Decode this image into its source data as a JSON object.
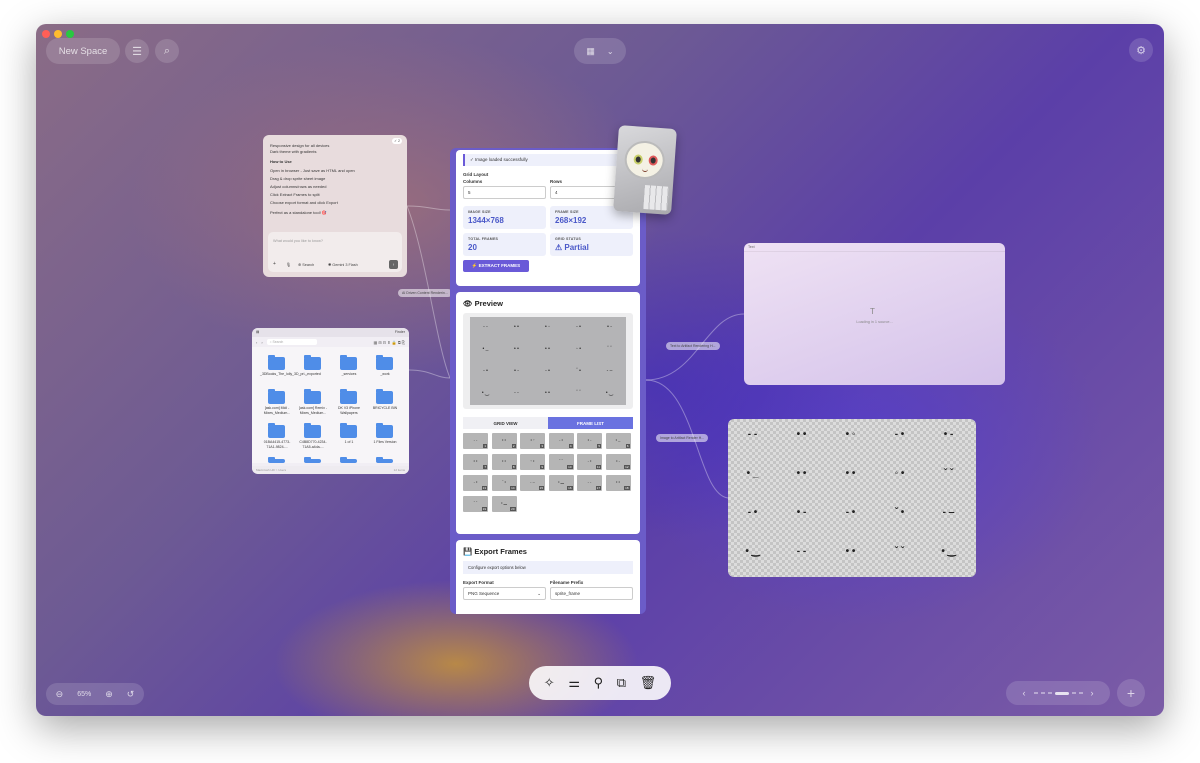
{
  "topbar": {
    "space_label": "New Space",
    "zoom_level": "65%"
  },
  "icons": {
    "menu": "menu-icon",
    "search": "search-icon",
    "grid": "grid-icon",
    "chevron": "chevron-down-icon",
    "settings": "gear-icon",
    "add": "plus-icon"
  },
  "chat_note": {
    "badge": "✓ 2",
    "lines": [
      "Responsive design for all devices",
      "Dark theme with gradients",
      "How to Use",
      "Open in browser - Just save as HTML and open",
      "Drag & drop sprite sheet image",
      "Adjust columns/rows as needed",
      "Click Extract Frames to split",
      "Choose export format and click Export",
      "Perfect as a standalone tool! 🎯"
    ],
    "input_placeholder": "What would you like to know?",
    "search_label": "Search",
    "model_label": "Gemini 3 Flash"
  },
  "connectors": {
    "c1": "AI Driven Content Renderin...",
    "c2": "Text to Artifact Rendering H...",
    "c3": "Image to Artifact Render H..."
  },
  "finder": {
    "title": "Finder",
    "search_placeholder": "Search",
    "folders": [
      "_3DBooks_The_lolly_3D_pri...",
      "_exported",
      "_services",
      "_work",
      "[ask.com] Midi - Mixes_Medium...",
      "[ask.com] Remix - Mixes_Medium...",
      "DK V3 iPhone Wallpapers",
      "BRICYCLE BIN",
      "01BA4415-4773-71A1-9824-...",
      "C4B8D770-4234-71A5-a4da-...",
      "1 of 1",
      "1 Files Version"
    ],
    "footer_left": "Macintosh HD > Users",
    "footer_right": "12 items"
  },
  "extractor": {
    "status": "✓ Image loaded successfully",
    "grid_title": "Grid Layout",
    "columns_label": "Columns",
    "columns_value": "5",
    "rows_label": "Rows",
    "rows_value": "4",
    "stats": [
      {
        "key": "IMAGE SIZE",
        "value": "1344×768"
      },
      {
        "key": "FRAME SIZE",
        "value": "268×192"
      },
      {
        "key": "TOTAL FRAMES",
        "value": "20"
      },
      {
        "key": "GRID STATUS",
        "value": "⚠ Partial"
      }
    ],
    "extract_button": "⚡ EXTRACT FRAMES",
    "preview_title": "👁 Preview",
    "grid_view_tab": "GRID VIEW",
    "frame_list_tab": "FRAME LIST",
    "export_title": "💾 Export Frames",
    "export_note": "Configure export options below",
    "format_label": "Export Format",
    "format_value": "PNG Sequence",
    "prefix_label": "Filename Prefix",
    "prefix_value": "sprite_frame"
  },
  "text_card": {
    "title": "Text",
    "loading": "Loading in 1 source..."
  },
  "faces": [
    "- -",
    "• •",
    "• ◦",
    "- •",
    "• -",
    "• _",
    "• •",
    "• •",
    "◦ •",
    "ˇ ˇ",
    "- •",
    "• -",
    "- •",
    "ˇ •",
    "- ‒",
    "• ‿",
    "- -",
    "• •",
    "ˇ ˇ",
    "• ‿"
  ],
  "frame_numbers": [
    "1",
    "2",
    "3",
    "4",
    "5",
    "6",
    "7",
    "8",
    "9",
    "10",
    "11",
    "12",
    "13",
    "14",
    "15",
    "16",
    "17",
    "18",
    "19",
    "20"
  ],
  "colors": {
    "accent": "#6a5ad8",
    "accent_light": "#eef0fb",
    "brand_gradient_start": "#8a6c86",
    "brand_gradient_end": "#5b3fa8"
  }
}
